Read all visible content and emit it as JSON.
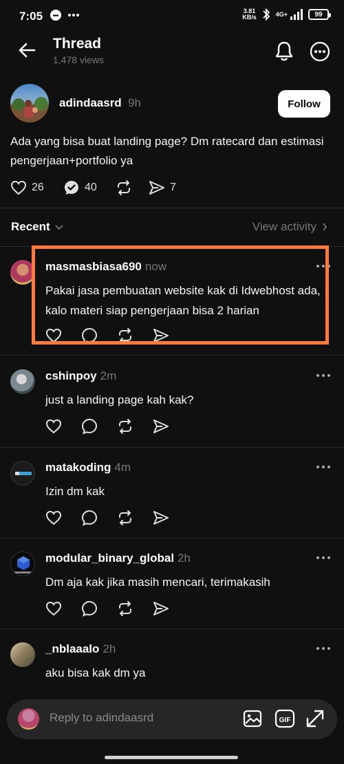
{
  "status_bar": {
    "time": "7:05",
    "net_speed_value": "3.81",
    "net_speed_unit": "KB/s",
    "network": "4G+",
    "battery": "99"
  },
  "header": {
    "title": "Thread",
    "views": "1,478 views"
  },
  "post": {
    "username": "adindaasrd",
    "time": "9h",
    "follow_label": "Follow",
    "text": "Ada yang bisa buat landing page? Dm ratecard dan estimasi pengerjaan+portfolio ya",
    "likes": "26",
    "replies": "40",
    "shares": "7"
  },
  "filter": {
    "sort_label": "Recent",
    "activity_label": "View activity"
  },
  "replies": [
    {
      "username": "masmasbiasa690",
      "time": "now",
      "text": "Pakai jasa pembuatan website kak di Idwebhost ada, kalo materi siap pengerjaan bisa 2 harian"
    },
    {
      "username": "cshinpoy",
      "time": "2m",
      "text": "just a landing page kah kak?"
    },
    {
      "username": "matakoding",
      "time": "4m",
      "text": "Izin dm kak"
    },
    {
      "username": "modular_binary_global",
      "time": "2h",
      "text": "Dm aja kak jika masih mencari, terimakasih"
    },
    {
      "username": "_nblaaalo",
      "time": "2h",
      "text": "aku bisa kak dm ya"
    }
  ],
  "composer": {
    "placeholder": "Reply to adindaasrd"
  },
  "colors": {
    "background": "#101010",
    "highlight": "#ff7a3c",
    "muted": "#777777"
  }
}
